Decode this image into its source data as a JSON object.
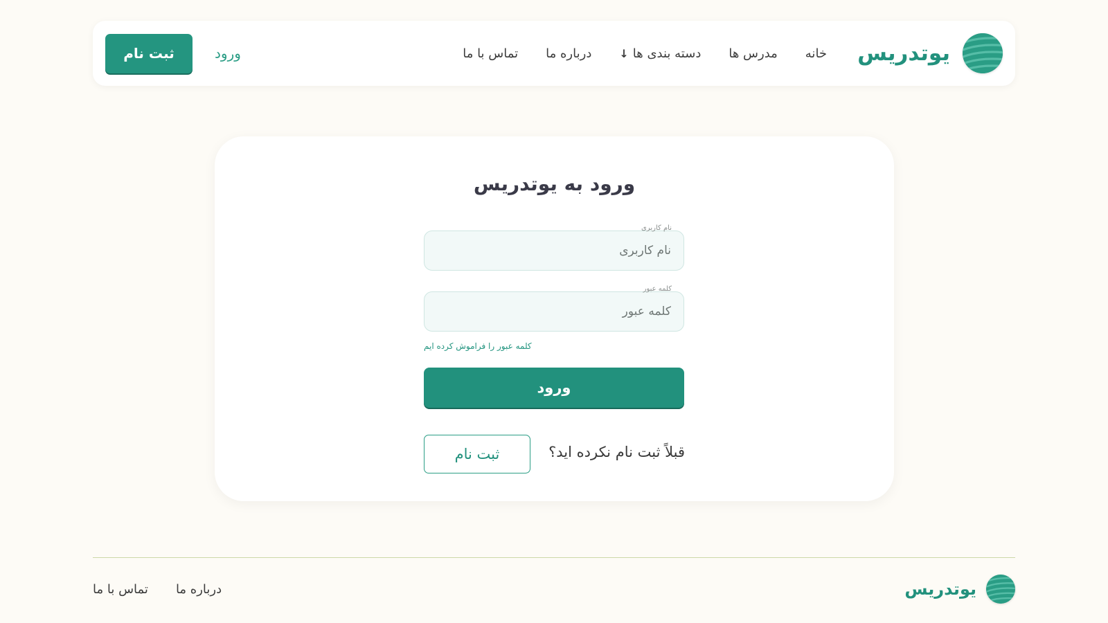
{
  "brand": {
    "name": "یوتدریس",
    "logo_icon": "striped-globe-icon",
    "accent": "#22917d"
  },
  "nav": {
    "items": [
      {
        "label": "خانه"
      },
      {
        "label": "مدرس ها"
      },
      {
        "label": "دسته بندی ها",
        "icon": "arrow-down-icon"
      },
      {
        "label": "درباره ما"
      },
      {
        "label": "تماس با ما"
      }
    ]
  },
  "auth": {
    "login_label": "ورود",
    "signup_label": "ثبت نام"
  },
  "login_card": {
    "title": "ورود به یوتدریس",
    "username": {
      "label": "نام کاربری",
      "placeholder": "نام کاربری",
      "value": ""
    },
    "password": {
      "label": "کلمه عبور",
      "placeholder": "کلمه عبور",
      "value": ""
    },
    "forgot_label": "کلمه عبور را فراموش کرده ایم",
    "submit_label": "ورود",
    "no_account_text": "قبلاً ثبت نام نکرده اید؟",
    "register_label": "ثبت نام"
  },
  "footer": {
    "brand_name": "یوتدریس",
    "links": [
      {
        "label": "درباره ما"
      },
      {
        "label": "تماس با ما"
      }
    ]
  }
}
